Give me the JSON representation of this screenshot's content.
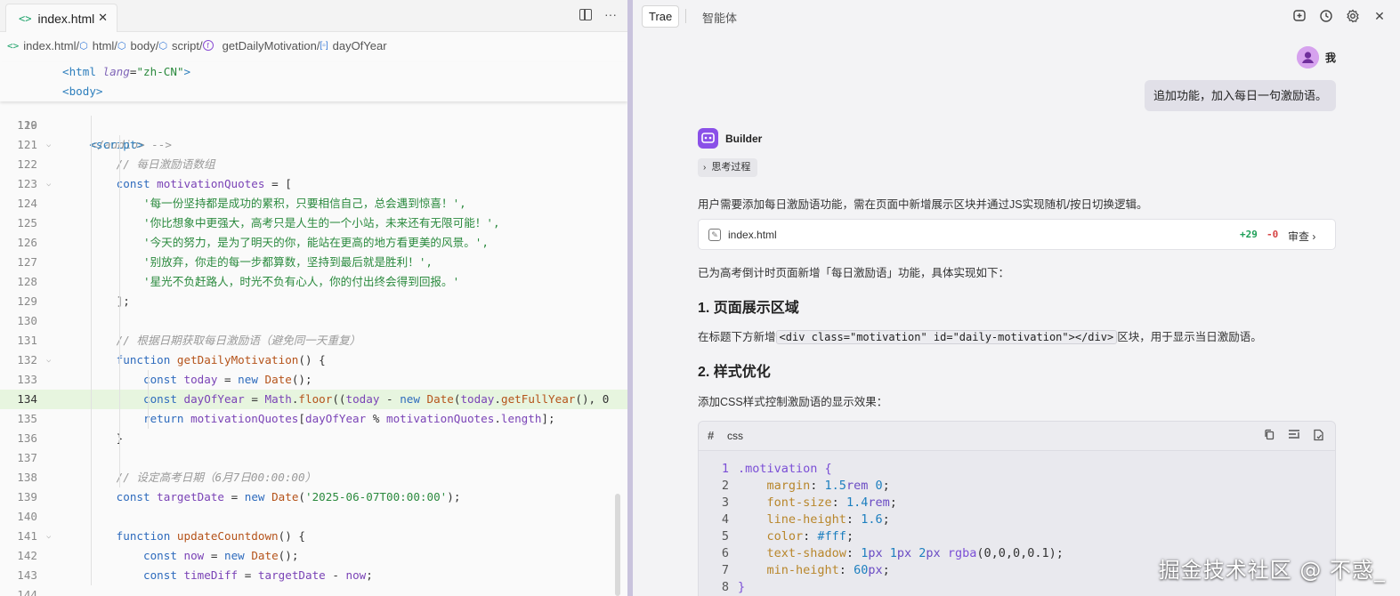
{
  "editor": {
    "tab": {
      "icon": "html-file-icon",
      "label": "index.html",
      "close": "✕"
    },
    "tab_tools": {
      "split": "split-editor-icon",
      "more": "···"
    },
    "breadcrumb": [
      "index.html",
      "html",
      "body",
      "script",
      "getDailyMotivation",
      "dayOfYear"
    ],
    "sticky": [
      {
        "tag_open": "<html",
        "attr": "lang",
        "eq": "=",
        "value": "\"zh-CN\"",
        "tag_close": ">"
      },
      {
        "tag": "<body>"
      }
    ],
    "partial_line": {
      "number": "119",
      "text": "</audio> -->"
    },
    "lines": [
      {
        "n": "120",
        "parts": []
      },
      {
        "n": "121",
        "parts": [
          [
            "t-tag",
            "    <script>"
          ]
        ]
      },
      {
        "n": "122",
        "parts": [
          [
            "t-cmt",
            "        // 每日激励语数组"
          ]
        ]
      },
      {
        "n": "123",
        "parts": [
          [
            "t-kw",
            "        const "
          ],
          [
            "t-var",
            "motivationQuotes"
          ],
          [
            "t-pl",
            " = ["
          ]
        ]
      },
      {
        "n": "124",
        "parts": [
          [
            "t-str",
            "            '每一份坚持都是成功的累积，只要相信自己，总会遇到惊喜！',"
          ]
        ]
      },
      {
        "n": "125",
        "parts": [
          [
            "t-str",
            "            '你比想象中更强大，高考只是人生的一个小站，未来还有无限可能！',"
          ]
        ]
      },
      {
        "n": "126",
        "parts": [
          [
            "t-str",
            "            '今天的努力，是为了明天的你，能站在更高的地方看更美的风景。',"
          ]
        ]
      },
      {
        "n": "127",
        "parts": [
          [
            "t-str",
            "            '别放弃，你走的每一步都算数，坚持到最后就是胜利！',"
          ]
        ]
      },
      {
        "n": "128",
        "parts": [
          [
            "t-str",
            "            '星光不负赶路人，时光不负有心人，你的付出终会得到回报。'"
          ]
        ]
      },
      {
        "n": "129",
        "parts": [
          [
            "t-pl",
            "        ];"
          ]
        ]
      },
      {
        "n": "130",
        "parts": []
      },
      {
        "n": "131",
        "parts": [
          [
            "t-cmt",
            "        // 根据日期获取每日激励语（避免同一天重复）"
          ]
        ]
      },
      {
        "n": "132",
        "parts": [
          [
            "t-kw",
            "        function "
          ],
          [
            "t-fn",
            "getDailyMotivation"
          ],
          [
            "t-pl",
            "() {"
          ]
        ]
      },
      {
        "n": "133",
        "parts": [
          [
            "t-kw",
            "            const "
          ],
          [
            "t-var",
            "today"
          ],
          [
            "t-pl",
            " = "
          ],
          [
            "t-kw",
            "new "
          ],
          [
            "t-fn",
            "Date"
          ],
          [
            "t-pl",
            "();"
          ]
        ]
      },
      {
        "n": "134",
        "parts": [
          [
            "t-kw",
            "            const "
          ],
          [
            "t-var",
            "dayOfYear"
          ],
          [
            "t-pl",
            " = "
          ],
          [
            "t-var",
            "Math"
          ],
          [
            "t-pl",
            "."
          ],
          [
            "t-fn",
            "floor"
          ],
          [
            "t-pl",
            "(("
          ],
          [
            "t-var",
            "today"
          ],
          [
            "t-pl",
            " - "
          ],
          [
            "t-kw",
            "new "
          ],
          [
            "t-fn",
            "Date"
          ],
          [
            "t-pl",
            "("
          ],
          [
            "t-var",
            "today"
          ],
          [
            "t-pl",
            "."
          ],
          [
            "t-fn",
            "getFullYear"
          ],
          [
            "t-pl",
            "(), 0"
          ]
        ]
      },
      {
        "n": "135",
        "parts": [
          [
            "t-kw",
            "            return "
          ],
          [
            "t-var",
            "motivationQuotes"
          ],
          [
            "t-pl",
            "["
          ],
          [
            "t-var",
            "dayOfYear"
          ],
          [
            "t-pl",
            " % "
          ],
          [
            "t-var",
            "motivationQuotes"
          ],
          [
            "t-pl",
            "."
          ],
          [
            "t-var",
            "length"
          ],
          [
            "t-pl",
            "];"
          ]
        ]
      },
      {
        "n": "136",
        "parts": [
          [
            "t-pl",
            "        }"
          ]
        ]
      },
      {
        "n": "137",
        "parts": []
      },
      {
        "n": "138",
        "parts": [
          [
            "t-cmt",
            "        // 设定高考日期（6月7日00:00:00）"
          ]
        ]
      },
      {
        "n": "139",
        "parts": [
          [
            "t-kw",
            "        const "
          ],
          [
            "t-var",
            "targetDate"
          ],
          [
            "t-pl",
            " = "
          ],
          [
            "t-kw",
            "new "
          ],
          [
            "t-fn",
            "Date"
          ],
          [
            "t-pl",
            "("
          ],
          [
            "t-str",
            "'2025-06-07T00:00:00'"
          ],
          [
            "t-pl",
            ");"
          ]
        ]
      },
      {
        "n": "140",
        "parts": []
      },
      {
        "n": "141",
        "parts": [
          [
            "t-kw",
            "        function "
          ],
          [
            "t-fn",
            "updateCountdown"
          ],
          [
            "t-pl",
            "() {"
          ]
        ]
      },
      {
        "n": "142",
        "parts": [
          [
            "t-kw",
            "            const "
          ],
          [
            "t-var",
            "now"
          ],
          [
            "t-pl",
            " = "
          ],
          [
            "t-kw",
            "new "
          ],
          [
            "t-fn",
            "Date"
          ],
          [
            "t-pl",
            "();"
          ]
        ]
      },
      {
        "n": "143",
        "parts": [
          [
            "t-kw",
            "            const "
          ],
          [
            "t-var",
            "timeDiff"
          ],
          [
            "t-pl",
            " = "
          ],
          [
            "t-var",
            "targetDate"
          ],
          [
            "t-pl",
            " - "
          ],
          [
            "t-var",
            "now"
          ],
          [
            "t-pl",
            ";"
          ]
        ]
      },
      {
        "n": "144",
        "parts": []
      }
    ],
    "highlighted_line": "134"
  },
  "chat": {
    "mode_button": "Trae",
    "mode_tab": "智能体",
    "header_icons": [
      "new-chat-icon",
      "history-icon",
      "settings-icon",
      "close-icon"
    ],
    "user": {
      "name": "我",
      "message": "追加功能，加入每日一句激励语。"
    },
    "bot": {
      "name": "Builder",
      "think_label": "思考过程",
      "intro": "用户需要添加每日激励语功能，需在页面中新增展示区块并通过JS实现随机/按日切换逻辑。",
      "file": {
        "name": "index.html",
        "added": "+29",
        "removed": "-0",
        "review": "审查"
      },
      "summary": "已为高考倒计时页面新增「每日激励语」功能，具体实现如下：",
      "h1": "1. 页面展示区域",
      "p1_before": "在标题下方新增",
      "p1_code": "<div class=\"motivation\" id=\"daily-motivation\"></div>",
      "p1_after": "区块，用于显示当日激励语。",
      "h2": "2. 样式优化",
      "p2": "添加CSS样式控制激励语的显示效果：",
      "codeblock": {
        "lang": "css",
        "lines": [
          {
            "n": "1",
            "parts": [
              [
                "c-sel",
                ".motivation {"
              ]
            ]
          },
          {
            "n": "2",
            "parts": [
              [
                "c-prop",
                "    margin"
              ],
              [
                "c-pl",
                ": "
              ],
              [
                "c-num",
                "1.5"
              ],
              [
                "c-unit",
                "rem"
              ],
              [
                "c-pl",
                " "
              ],
              [
                "c-num",
                "0"
              ],
              [
                "c-pl",
                ";"
              ]
            ]
          },
          {
            "n": "3",
            "parts": [
              [
                "c-prop",
                "    font-size"
              ],
              [
                "c-pl",
                ": "
              ],
              [
                "c-num",
                "1.4"
              ],
              [
                "c-unit",
                "rem"
              ],
              [
                "c-pl",
                ";"
              ]
            ]
          },
          {
            "n": "4",
            "parts": [
              [
                "c-prop",
                "    line-height"
              ],
              [
                "c-pl",
                ": "
              ],
              [
                "c-num",
                "1.6"
              ],
              [
                "c-pl",
                ";"
              ]
            ]
          },
          {
            "n": "5",
            "parts": [
              [
                "c-prop",
                "    color"
              ],
              [
                "c-pl",
                ": "
              ],
              [
                "c-num",
                "#fff"
              ],
              [
                "c-pl",
                ";"
              ]
            ]
          },
          {
            "n": "6",
            "parts": [
              [
                "c-prop",
                "    text-shadow"
              ],
              [
                "c-pl",
                ": "
              ],
              [
                "c-num",
                "1"
              ],
              [
                "c-unit",
                "px"
              ],
              [
                "c-pl",
                " "
              ],
              [
                "c-num",
                "1"
              ],
              [
                "c-unit",
                "px"
              ],
              [
                "c-pl",
                " "
              ],
              [
                "c-num",
                "2"
              ],
              [
                "c-unit",
                "px"
              ],
              [
                "c-pl",
                " "
              ],
              [
                "c-fn",
                "rgba"
              ],
              [
                "c-pl",
                "(0,0,0,0.1);"
              ]
            ]
          },
          {
            "n": "7",
            "parts": [
              [
                "c-prop",
                "    min-height"
              ],
              [
                "c-pl",
                ": "
              ],
              [
                "c-num",
                "60"
              ],
              [
                "c-unit",
                "px"
              ],
              [
                "c-pl",
                ";"
              ]
            ]
          },
          {
            "n": "8",
            "parts": [
              [
                "c-sel",
                "}"
              ]
            ]
          }
        ]
      }
    }
  },
  "watermark": "掘金技术社区 @ 不惑_",
  "colors": {
    "accent": "#8a50e8",
    "added": "#1d9f57",
    "removed": "#d64545",
    "highlight_line": "#e7f5df"
  }
}
